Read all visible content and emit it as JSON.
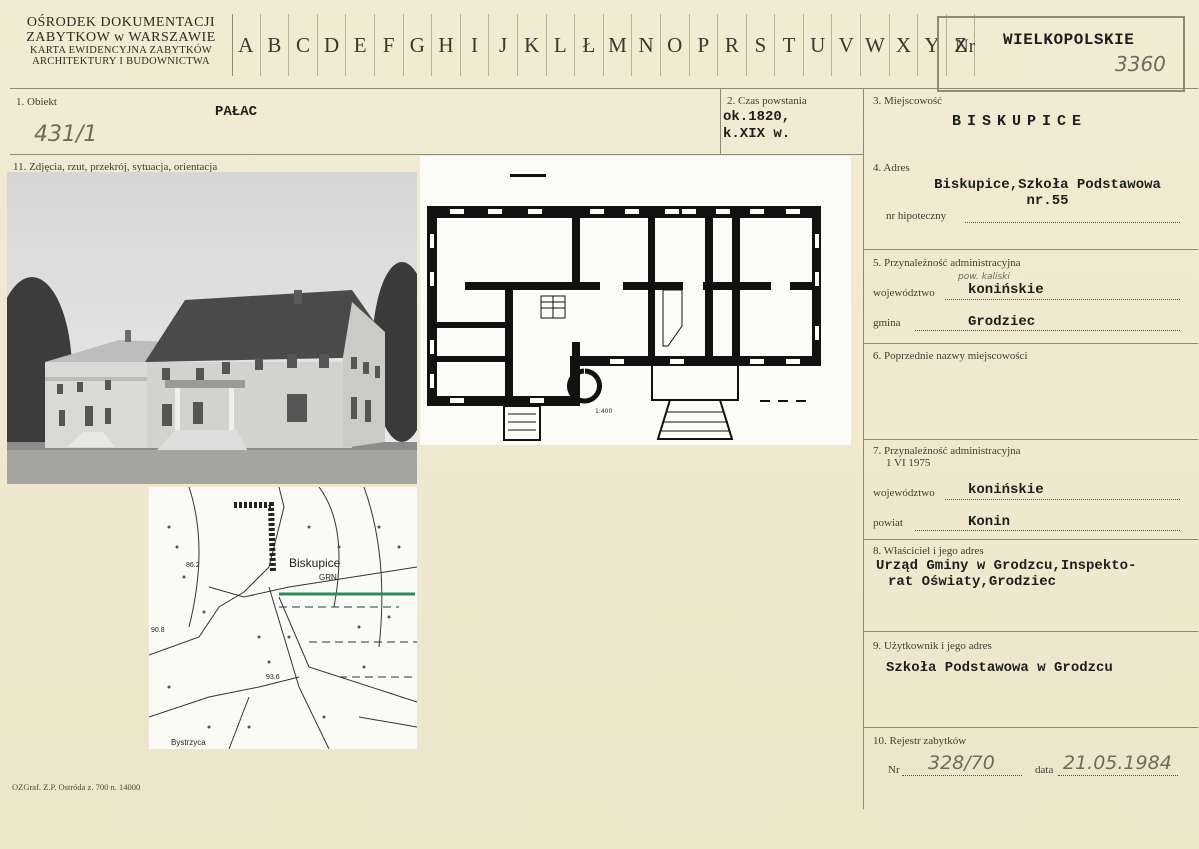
{
  "header": {
    "org_line1": "OŚRODEK DOKUMENTACJI",
    "org_line2": "ZABYTKOW w WARSZAWIE",
    "org_line3": "KARTA EWIDENCYJNA ZABYTKÓW",
    "org_line4": "ARCHITEKTURY I BUDOWNICTWA",
    "letters": [
      "A",
      "B",
      "C",
      "D",
      "E",
      "F",
      "G",
      "H",
      "I",
      "J",
      "K",
      "L",
      "Ł",
      "M",
      "N",
      "O",
      "P",
      "R",
      "S",
      "T",
      "U",
      "V",
      "W",
      "X",
      "Y",
      "Z"
    ],
    "nr_label": "Nr",
    "region": "WIELKOPOLSKIE",
    "region_number": "3360"
  },
  "fields": {
    "obiekt": {
      "label": "1. Obiekt",
      "value": "PAŁAC",
      "handwritten": "431/1"
    },
    "czas": {
      "label": "2. Czas powstania",
      "line1": "ok.1820,",
      "line2": "k.XIX w."
    },
    "miejscowosc": {
      "label": "3. Miejscowość",
      "value": "BISKUPICE"
    },
    "zdjecia": {
      "label": "11. Zdjęcia, rzut, przekrój, sytuacja, orientacja"
    },
    "adres": {
      "label": "4. Adres",
      "line1": "Biskupice,Szkoła Podstawowa",
      "line2": "nr.55",
      "hipoteczny_label": "nr hipoteczny"
    },
    "przynaleznosc": {
      "label": "5. Przynależność administracyjna",
      "woj_label": "województwo",
      "woj_value": "konińskie",
      "woj_note": "pow. kaliski",
      "gmina_label": "gmina",
      "gmina_value": "Grodziec"
    },
    "poprzednie": {
      "label": "6. Poprzednie nazwy miejscowości"
    },
    "przynaleznosc_1975": {
      "label": "7. Przynależność administracyjna",
      "date": "1 VI 1975",
      "woj_label": "województwo",
      "woj_value": "konińskie",
      "powiat_label": "powiat",
      "powiat_value": "Konin"
    },
    "wlasciciel": {
      "label": "8. Właściciel i jego adres",
      "line1": "Urząd Gminy w Grodzcu,Inspekto-",
      "line2": "rat Oświaty,Grodziec"
    },
    "uzytkownik": {
      "label": "9. Użytkownik i jego adres",
      "value": "Szkoła Podstawowa w Grodzcu"
    },
    "rejestr": {
      "label": "10. Rejestr zabytków",
      "nr_label": "Nr",
      "nr_value": "328/70",
      "data_label": "data",
      "data_value": "21.05.1984"
    }
  },
  "map": {
    "place": "Biskupice",
    "grn": "GRN",
    "elev1": "86.2",
    "elev2": "90.8",
    "elev3": "93.6",
    "river": "Bystrzyca"
  },
  "plan": {
    "scale": "1:400"
  },
  "footer": "OZGraf. Z.P. Ostróda z. 700 n. 14000"
}
